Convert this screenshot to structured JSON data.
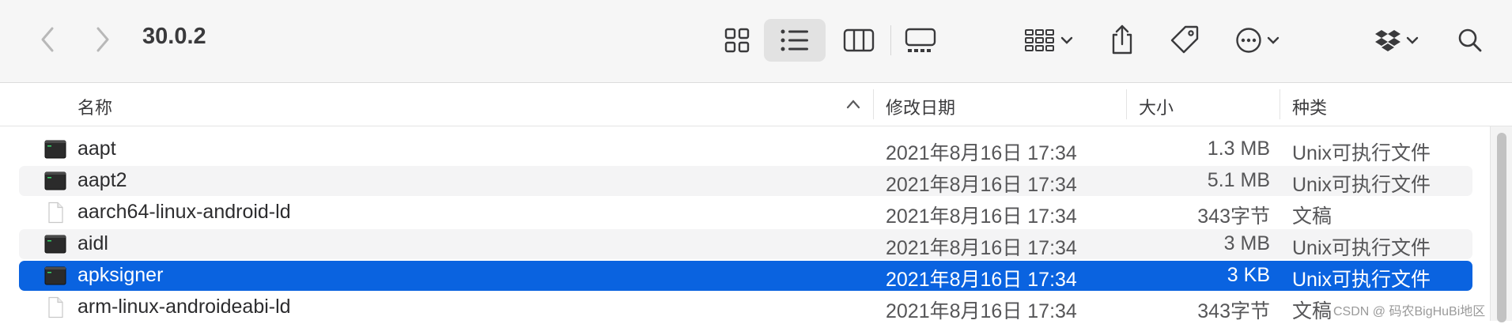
{
  "window": {
    "title": "30.0.2"
  },
  "toolbar": {
    "back_icon": "chevron-left-icon",
    "forward_icon": "chevron-right-icon",
    "view_modes": [
      "icon-grid-icon",
      "list-icon",
      "columns-icon",
      "gallery-icon"
    ],
    "active_view": "list-icon",
    "actions": [
      "group-icon",
      "share-icon",
      "tag-icon",
      "more-icon",
      "dropbox-icon",
      "search-icon"
    ]
  },
  "columns": {
    "name": "名称",
    "modified": "修改日期",
    "size": "大小",
    "kind": "种类"
  },
  "files": [
    {
      "icon": "terminal-exec-icon",
      "name": "aapt",
      "modified": "2021年8月16日 17:34",
      "size": "1.3 MB",
      "kind": "Unix可执行文件"
    },
    {
      "icon": "terminal-exec-icon",
      "name": "aapt2",
      "modified": "2021年8月16日 17:34",
      "size": "5.1 MB",
      "kind": "Unix可执行文件"
    },
    {
      "icon": "document-icon",
      "name": "aarch64-linux-android-ld",
      "modified": "2021年8月16日 17:34",
      "size": "343字节",
      "kind": "文稿"
    },
    {
      "icon": "terminal-exec-icon",
      "name": "aidl",
      "modified": "2021年8月16日 17:34",
      "size": "3 MB",
      "kind": "Unix可执行文件"
    },
    {
      "icon": "terminal-exec-icon",
      "name": "apksigner",
      "modified": "2021年8月16日 17:34",
      "size": "3 KB",
      "kind": "Unix可执行文件",
      "selected": true
    },
    {
      "icon": "document-icon",
      "name": "arm-linux-androideabi-ld",
      "modified": "2021年8月16日 17:34",
      "size": "343字节",
      "kind": "文稿"
    }
  ],
  "watermark": "CSDN @ 码农BigHuBi地区",
  "colors": {
    "selection": "#0a63e0",
    "toolbar_bg": "#f6f6f6",
    "alt_row": "#f4f4f5"
  }
}
